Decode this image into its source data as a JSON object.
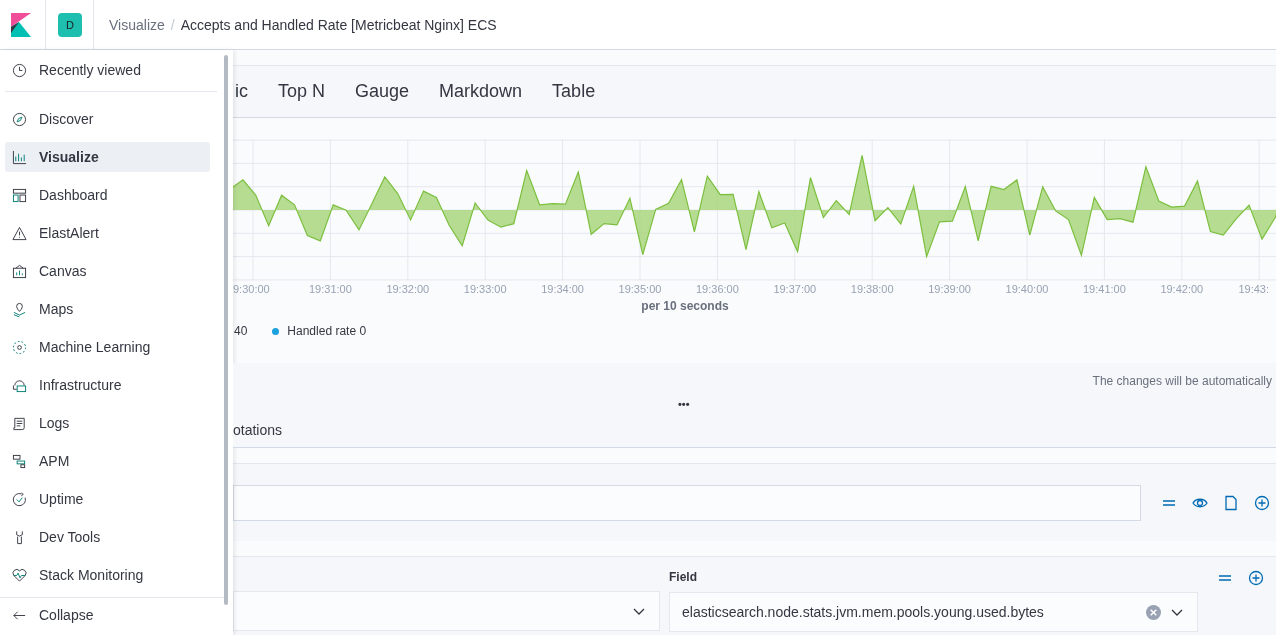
{
  "header": {
    "avatar": "D",
    "separator": "/",
    "breadcrumbs": [
      {
        "label": "Visualize",
        "current": false
      },
      {
        "label": "Accepts and Handled Rate [Metricbeat Nginx] ECS",
        "current": true
      }
    ]
  },
  "nav": {
    "recent": "Recently viewed",
    "items": [
      {
        "label": "Discover",
        "selected": false
      },
      {
        "label": "Visualize",
        "selected": true
      },
      {
        "label": "Dashboard",
        "selected": false
      },
      {
        "label": "ElastAlert",
        "selected": false
      },
      {
        "label": "Canvas",
        "selected": false
      },
      {
        "label": "Maps",
        "selected": false
      },
      {
        "label": "Machine Learning",
        "selected": false
      },
      {
        "label": "Infrastructure",
        "selected": false
      },
      {
        "label": "Logs",
        "selected": false
      },
      {
        "label": "APM",
        "selected": false
      },
      {
        "label": "Uptime",
        "selected": false
      },
      {
        "label": "Dev Tools",
        "selected": false
      },
      {
        "label": "Stack Monitoring",
        "selected": false
      }
    ],
    "collapse": "Collapse"
  },
  "type_tabs": [
    "ic",
    "Top N",
    "Gauge",
    "Markdown",
    "Table"
  ],
  "chart": {
    "x_ticks": [
      "9:30:00",
      "19:31:00",
      "19:32:00",
      "19:33:00",
      "19:34:00",
      "19:35:00",
      "19:36:00",
      "19:37:00",
      "19:38:00",
      "19:39:00",
      "19:40:00",
      "19:41:00",
      "19:42:00",
      "19:43:"
    ],
    "x_title": "per 10 seconds",
    "legend": [
      {
        "label": "40"
      },
      {
        "label": "Handled rate 0",
        "color": "#1ba1dc"
      }
    ]
  },
  "editor": {
    "autosave_note": "The changes will be automatically",
    "more": "•••",
    "tab": "otations",
    "field_label": "Field",
    "field_value": "elasticsearch.node.stats.jvm.mem.pools.young.used.bytes"
  }
}
